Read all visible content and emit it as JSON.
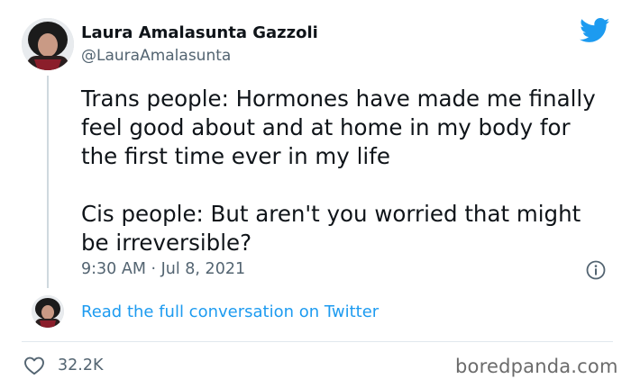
{
  "author": {
    "name": "Laura Amalasunta Gazzoli",
    "handle": "@LauraAmalasunta"
  },
  "tweet": {
    "paragraphs": [
      "Trans people: Hormones have made me finally feel good about and at home in my body for the first time ever in my life",
      "Cis people: But aren't you worried that might be irreversible?"
    ],
    "timestamp": "9:30 AM · Jul 8, 2021"
  },
  "thread": {
    "read_more": "Read the full conversation on Twitter"
  },
  "stats": {
    "likes": "32.2K"
  },
  "watermark": "boredpanda.com",
  "icons": {
    "brand": "twitter-bird-icon",
    "info": "info-icon",
    "like": "heart-icon"
  },
  "colors": {
    "twitter_blue": "#1d9bf0",
    "text_primary": "#0f1419",
    "text_secondary": "#536471",
    "divider": "#e1e8ed"
  }
}
